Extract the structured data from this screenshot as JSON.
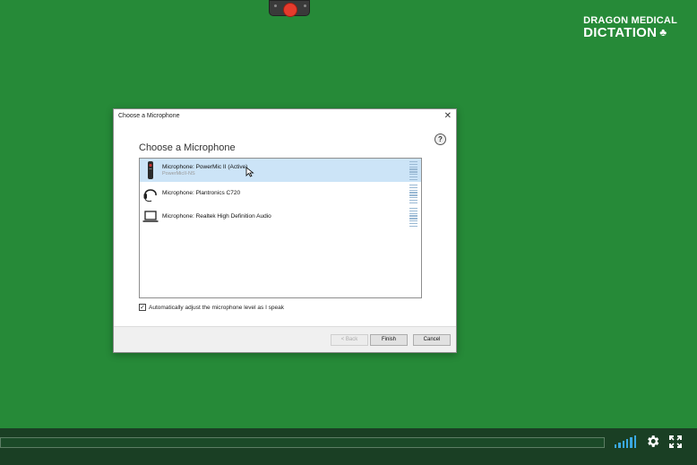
{
  "logo": {
    "line1": "DRAGON MEDICAL",
    "line2": "DICTATION",
    "clover": "♣"
  },
  "dialog": {
    "title": "Choose a Microphone",
    "close": "✕",
    "heading": "Choose a Microphone",
    "help": "?",
    "microphones": [
      {
        "name": "Microphone: PowerMic II (Active)",
        "sub": "PowerMicII-NS",
        "icon": "handheld-mic-icon",
        "selected": true
      },
      {
        "name": "Microphone: Plantronics C720",
        "sub": "",
        "icon": "headset-icon",
        "selected": false
      },
      {
        "name": "Microphone: Realtek High Definition Audio",
        "sub": "",
        "icon": "laptop-icon",
        "selected": false
      }
    ],
    "auto_adjust_label": "Automatically adjust the microphone level as I speak",
    "auto_adjust_checked": true,
    "buttons": {
      "back": "< Back",
      "finish": "Finish",
      "cancel": "Cancel"
    }
  },
  "colors": {
    "background": "#268a38",
    "selection": "#cce4f7",
    "record": "#e53b2c",
    "volume": "#3aa8e0"
  },
  "player": {
    "icons": [
      "volume-icon",
      "gear-icon",
      "fullscreen-icon"
    ]
  }
}
